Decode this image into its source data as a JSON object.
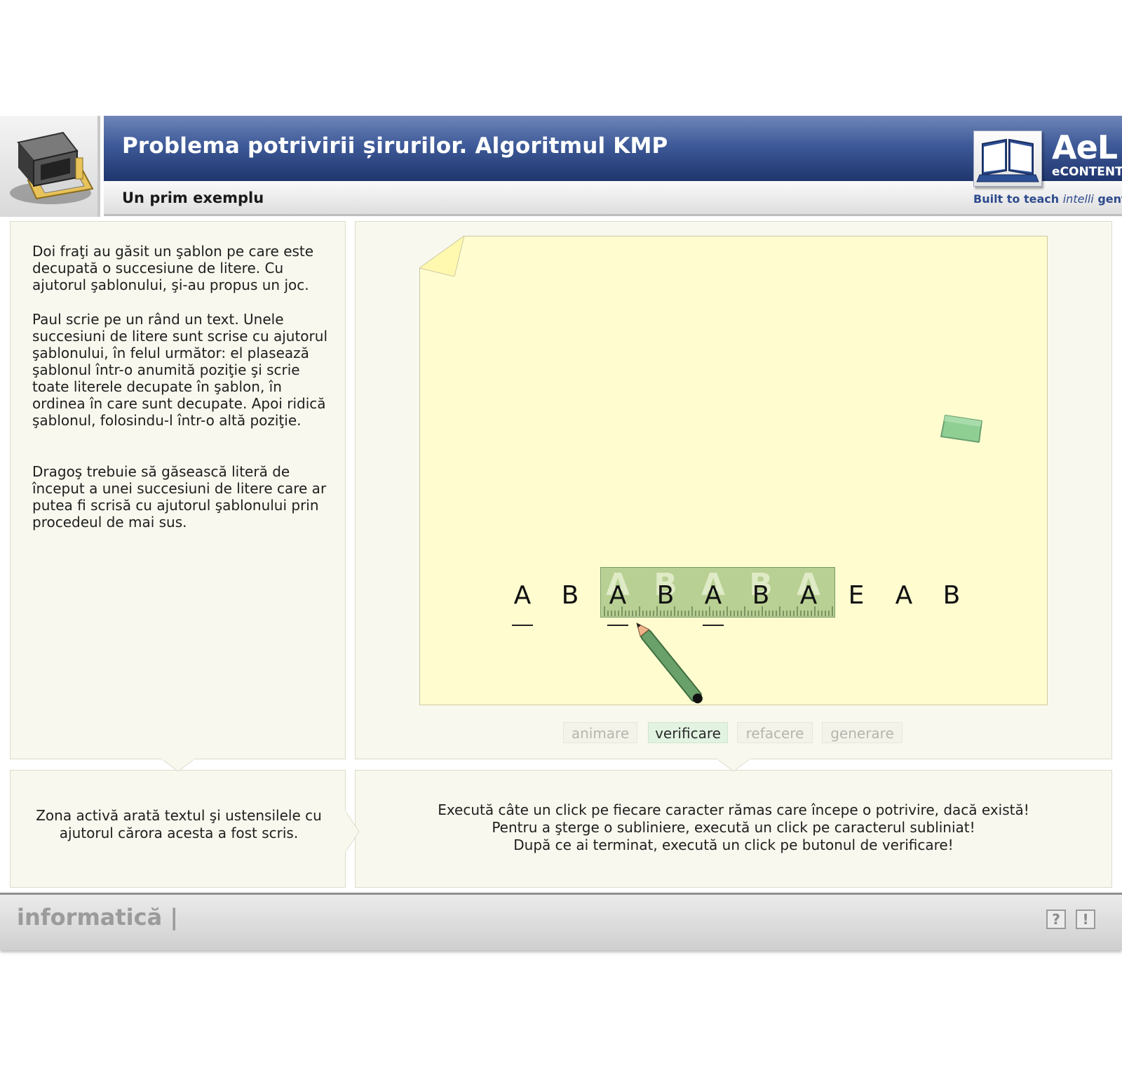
{
  "header": {
    "title": "Problema potrivirii șirurilor. Algoritmul KMP",
    "subtitle": "Un prim exemplu",
    "brand": "AeL",
    "brand_sub": "eCONTENT",
    "tagline_prefix": "Built to teach ",
    "tagline_italic": "intelli",
    "tagline_suffix": " gently"
  },
  "left_panel": {
    "paragraphs": [
      "Doi fraţi au găsit un şablon pe care este decupată o succesiune de litere. Cu ajutorul şablonului, şi-au propus un joc.",
      "Paul scrie pe un rând un text. Unele succesiuni de litere sunt scrise cu ajutorul şablonului, în felul următor: el plasează şablonul într-o anumită poziţie şi scrie toate literele decupate în şablon, în ordinea în care sunt decupate. Apoi ridică şablonul, folosindu-l într-o altă poziţie.",
      "Dragoş trebuie să găsească  literă de început a unei succesiuni de litere care ar putea fi scrisă cu ajutorul şablonului prin procedeul de mai sus."
    ],
    "hint": "Zona activă arată textul şi ustensilele cu ajutorul cărora acesta a fost scris."
  },
  "workspace": {
    "letters": [
      "A",
      "B",
      "A",
      "B",
      "A",
      "B",
      "A",
      "E",
      "A",
      "B"
    ],
    "underlined": [
      0,
      2,
      4
    ],
    "stencil_letters": [
      "A",
      "B",
      "A",
      "B",
      "A"
    ],
    "stencil_start": 2
  },
  "buttons": [
    {
      "label": "animare",
      "active": false
    },
    {
      "label": "verificare",
      "active": true
    },
    {
      "label": "refacere",
      "active": false
    },
    {
      "label": "generare",
      "active": false
    }
  ],
  "instructions": [
    "Execută câte un click pe fiecare caracter rămas care începe o potrivire, dacă există!",
    "Pentru a şterge o subliniere, execută un click pe caracterul subliniat!",
    "După ce ai terminat, execută un click pe butonul de verificare!"
  ],
  "footer": {
    "subject": "informatică",
    "separator": "|",
    "help_label": "?",
    "alert_label": "!"
  },
  "colors": {
    "header_blue": "#2d4b8d",
    "paper": "#fffdd0",
    "stencil": "#8cb46e",
    "active_button": "#e2f3e2"
  }
}
